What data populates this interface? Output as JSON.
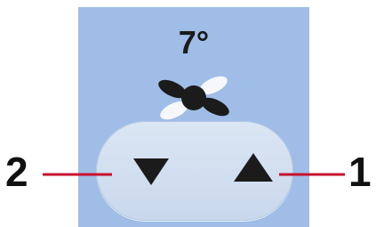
{
  "display": {
    "temperature": "7°",
    "fan_icon": "fan-icon"
  },
  "controls": {
    "down_button": {
      "icon": "triangle-down-icon"
    },
    "up_button": {
      "icon": "triangle-up-icon"
    }
  },
  "callouts": [
    {
      "label": "1",
      "target": "up_button"
    },
    {
      "label": "2",
      "target": "down_button"
    }
  ],
  "colors": {
    "panel_bg": "#9fbde6",
    "button_bg": "#d4e1f2",
    "callout_line": "#c8102e",
    "glyph": "#1b1b1b"
  }
}
